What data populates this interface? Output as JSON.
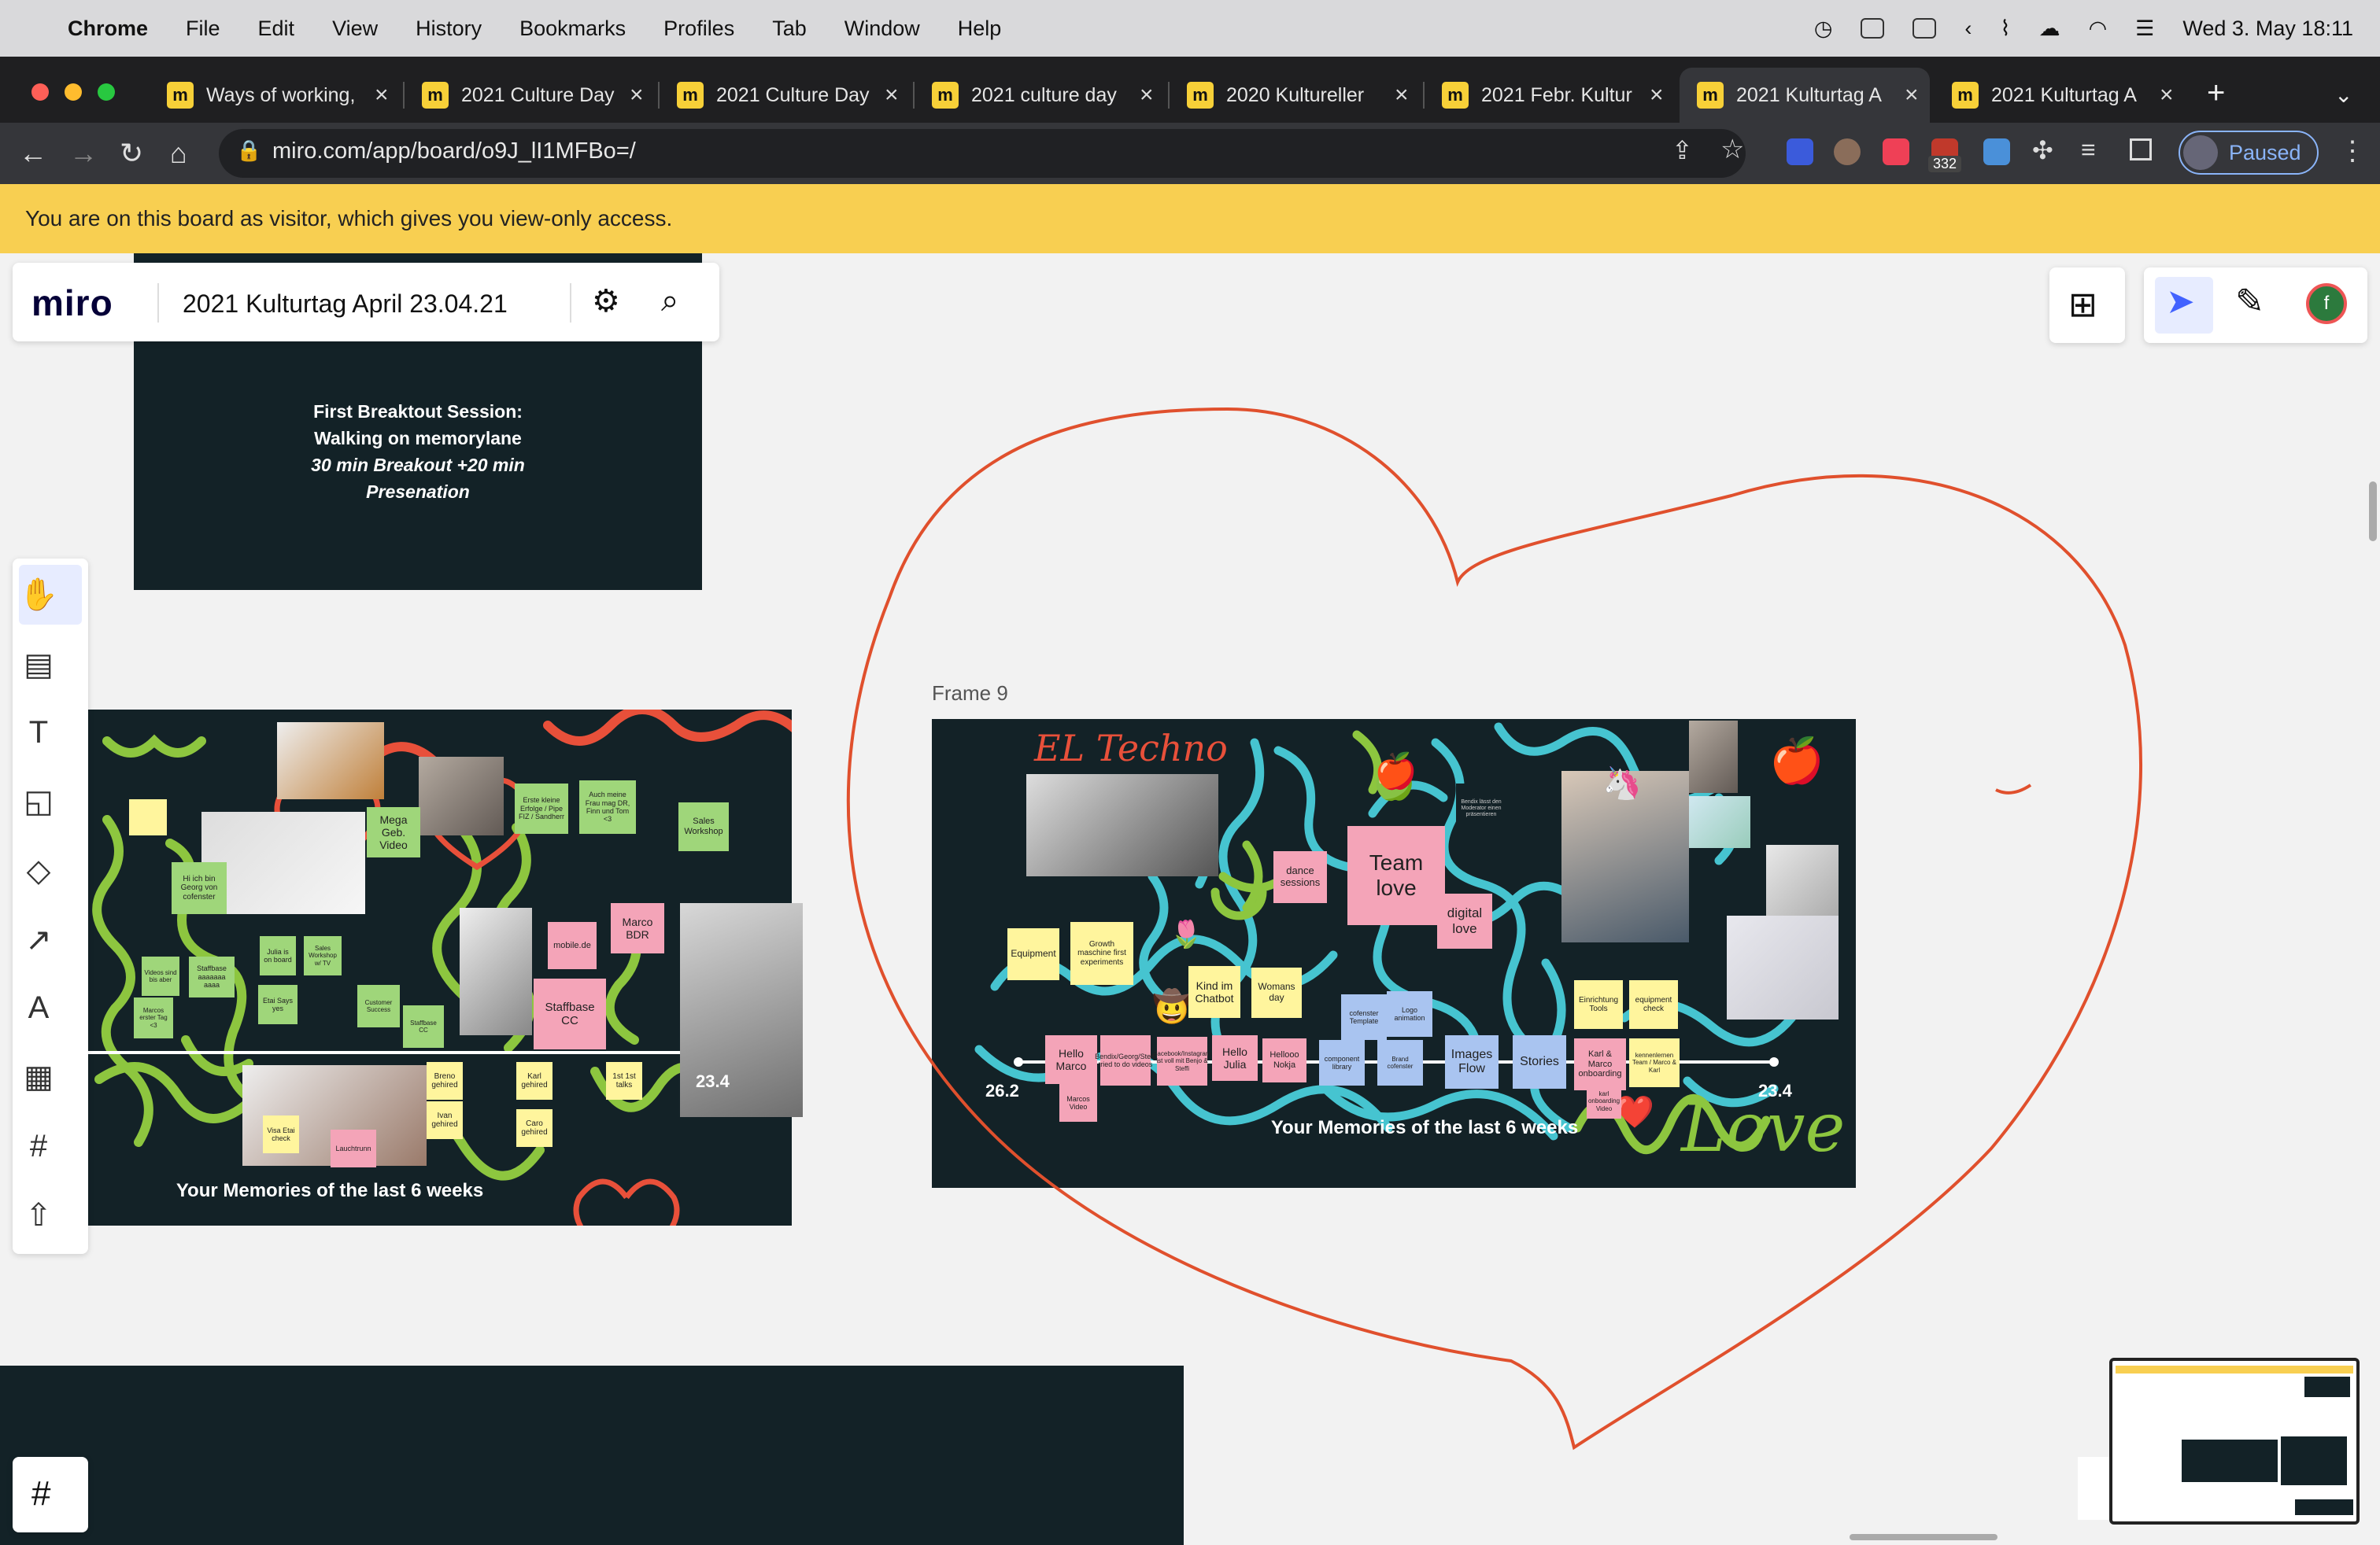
{
  "menubar": {
    "apple": "",
    "app": "Chrome",
    "items": [
      "File",
      "Edit",
      "View",
      "History",
      "Bookmarks",
      "Profiles",
      "Tab",
      "Window",
      "Help"
    ],
    "datetime": "Wed 3. May  18:11"
  },
  "tabs": [
    {
      "title": "Ways of working,"
    },
    {
      "title": "2021 Culture Day"
    },
    {
      "title": "2021 Culture Day"
    },
    {
      "title": "2021 culture day"
    },
    {
      "title": "2020 Kultureller"
    },
    {
      "title": "2021 Febr. Kultur"
    },
    {
      "title": "2021 Kulturtag A"
    },
    {
      "title": "2021 Kulturtag A"
    }
  ],
  "address": {
    "url": "miro.com/app/board/o9J_lI1MFBo=/",
    "paused": "Paused",
    "badge": "332"
  },
  "banner": "You are on this board as visitor, which gives you view-only access.",
  "miro": {
    "logo": "miro",
    "board_title": "2021 Kulturtag April 23.04.21",
    "avatar": "f"
  },
  "frames": {
    "breakout": {
      "line1": "First Breaktout Session:",
      "line2": "Walking on memorylane",
      "line3": "30 min Breakout +20 min",
      "line4": "Presenation"
    },
    "frame9_label": "Frame 9",
    "left_caption": "Your Memories of the last 6 weeks",
    "right_caption": "Your Memories of the last 6 weeks",
    "left_date": "23.4",
    "right_start": "26.2",
    "right_end": "23.4",
    "el_techno": "EL Techno",
    "love": "Love"
  },
  "left_stickies": [
    "Mega Geb. Video",
    "Erste kleine Erfolge / Pipe FIZ / Sandherr",
    "Auch meine Frau mag DR, Finn und Tom <3",
    "Sales Workshop",
    "Marco BDR",
    "mobile.de",
    "Staffbase CC",
    "1st 1st talks",
    "Karl gehired",
    "Caro gehired",
    "Ivan gehired",
    "Breno gehired",
    "Visa Etai check",
    "Lauchtrunn",
    "Hi ich bin Georg von cofenster",
    "Julia is on board",
    "Sales Workshop w/ TV",
    "Staffbase aaaaaaa aaaa",
    "Videos sind bis aber",
    "Marcos erster Tag <3",
    "Etai Says yes",
    "Customer Success",
    "Staffbase CC"
  ],
  "right_stickies": [
    "Team love",
    "dance sessions",
    "digital love",
    "Equipment",
    "Growth maschine first experiments",
    "Kind im Chatbot",
    "Womans day",
    "Hello Marco",
    "Bendix/Georg/Steffi tried to do videos",
    "Facebook/Instagram ist voll mit Benjo & Steffi",
    "Hello Julia",
    "Hellooo Nokja",
    "Marcos Video",
    "cofenster Template",
    "Logo animation",
    "component library",
    "Brand cofenster",
    "Images Flow",
    "Stories",
    "Einrichtung Tools",
    "equipment check",
    "Karl & Marco onboarding",
    "kennenlernen Team / Marco & Karl",
    "karl onboarding Video",
    "Bendix lässt den Moderator einen präsentieren"
  ],
  "colors": {
    "banner": "#f8cf51",
    "frame": "#132227",
    "heart": "#e0502d",
    "squiggle_cyan": "#46c4d0",
    "squiggle_green": "#8dc63f",
    "squiggle_red": "#e8503a"
  }
}
